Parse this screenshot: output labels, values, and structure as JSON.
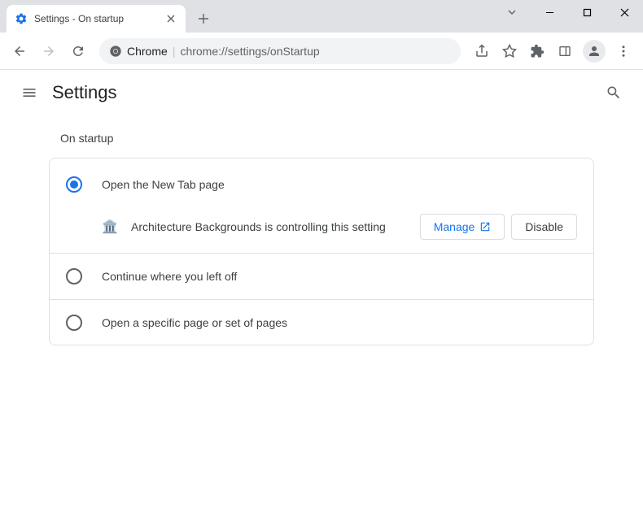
{
  "tab": {
    "title": "Settings - On startup"
  },
  "omnibox": {
    "prefix": "Chrome",
    "url": "chrome://settings/onStartup"
  },
  "header": {
    "title": "Settings"
  },
  "section": {
    "title": "On startup"
  },
  "options": {
    "open_new_tab": "Open the New Tab page",
    "continue": "Continue where you left off",
    "specific": "Open a specific page or set of pages"
  },
  "extension": {
    "message": "Architecture Backgrounds is controlling this setting",
    "manage": "Manage",
    "disable": "Disable"
  }
}
